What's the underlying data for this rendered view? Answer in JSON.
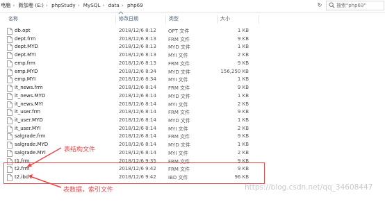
{
  "address": {
    "crumbs": [
      "电脑",
      "新加卷 (E:)",
      "phpStudy",
      "MySQL",
      "data",
      "php69"
    ],
    "search_placeholder": "搜索\"php69\""
  },
  "columns": {
    "name": "名称",
    "date": "修改日期",
    "type": "类型",
    "size": "大小"
  },
  "files": [
    {
      "name": "db.opt",
      "date": "2018/12/6 8:12",
      "type": "OPT 文件",
      "size": "1 KB"
    },
    {
      "name": "dept.frm",
      "date": "2018/12/6 8:13",
      "type": "FRM 文件",
      "size": "9 KB"
    },
    {
      "name": "dept.MYD",
      "date": "2018/12/6 8:13",
      "type": "MYD 文件",
      "size": "1 KB"
    },
    {
      "name": "dept.MYI",
      "date": "2018/12/6 8:13",
      "type": "MYI 文件",
      "size": "2 KB"
    },
    {
      "name": "emp.frm",
      "date": "2018/12/6 8:13",
      "type": "FRM 文件",
      "size": "9 KB"
    },
    {
      "name": "emp.MYD",
      "date": "2018/12/6 8:34",
      "type": "MYD 文件",
      "size": "156,250 KB"
    },
    {
      "name": "emp.MYI",
      "date": "2018/12/6 8:34",
      "type": "MYI 文件",
      "size": "1 KB"
    },
    {
      "name": "it_news.frm",
      "date": "2018/12/6 8:14",
      "type": "FRM 文件",
      "size": "9 KB"
    },
    {
      "name": "it_news.MYD",
      "date": "2018/12/6 8:14",
      "type": "MYD 文件",
      "size": "1 KB"
    },
    {
      "name": "it_news.MYI",
      "date": "2018/12/6 8:14",
      "type": "MYI 文件",
      "size": "2 KB"
    },
    {
      "name": "it_user.frm",
      "date": "2018/12/6 8:14",
      "type": "FRM 文件",
      "size": "9 KB"
    },
    {
      "name": "it_user.MYD",
      "date": "2018/12/6 8:14",
      "type": "MYD 文件",
      "size": "1 KB"
    },
    {
      "name": "it_user.MYI",
      "date": "2018/12/6 8:14",
      "type": "MYI 文件",
      "size": "2 KB"
    },
    {
      "name": "salgrade.frm",
      "date": "2018/12/6 8:14",
      "type": "FRM 文件",
      "size": "9 KB"
    },
    {
      "name": "salgrade.MYD",
      "date": "2018/12/6 8:14",
      "type": "MYD 文件",
      "size": "1 KB"
    },
    {
      "name": "salgrade.MYI",
      "date": "2018/12/6 8:14",
      "type": "MYI 文件",
      "size": "2 KB"
    },
    {
      "name": "t1.frm",
      "date": "2018/12/6 9:35",
      "type": "FRM 文件",
      "size": "9 KB"
    },
    {
      "name": "t2.frm",
      "date": "2018/12/6 9:42",
      "type": "FRM 文件",
      "size": "9 KB"
    },
    {
      "name": "t2.ibd",
      "date": "2018/12/6 9:42",
      "type": "IBD 文件",
      "size": "96 KB"
    }
  ],
  "annotations": {
    "structure_note": "表结构文件",
    "data_note": "表数据，索引文件"
  },
  "watermark": "https://blog.csdn.net/qq_34608447",
  "colors": {
    "annotation": "#e8474a",
    "header_text": "#4c607a",
    "watermark": "#c9c9c9"
  }
}
